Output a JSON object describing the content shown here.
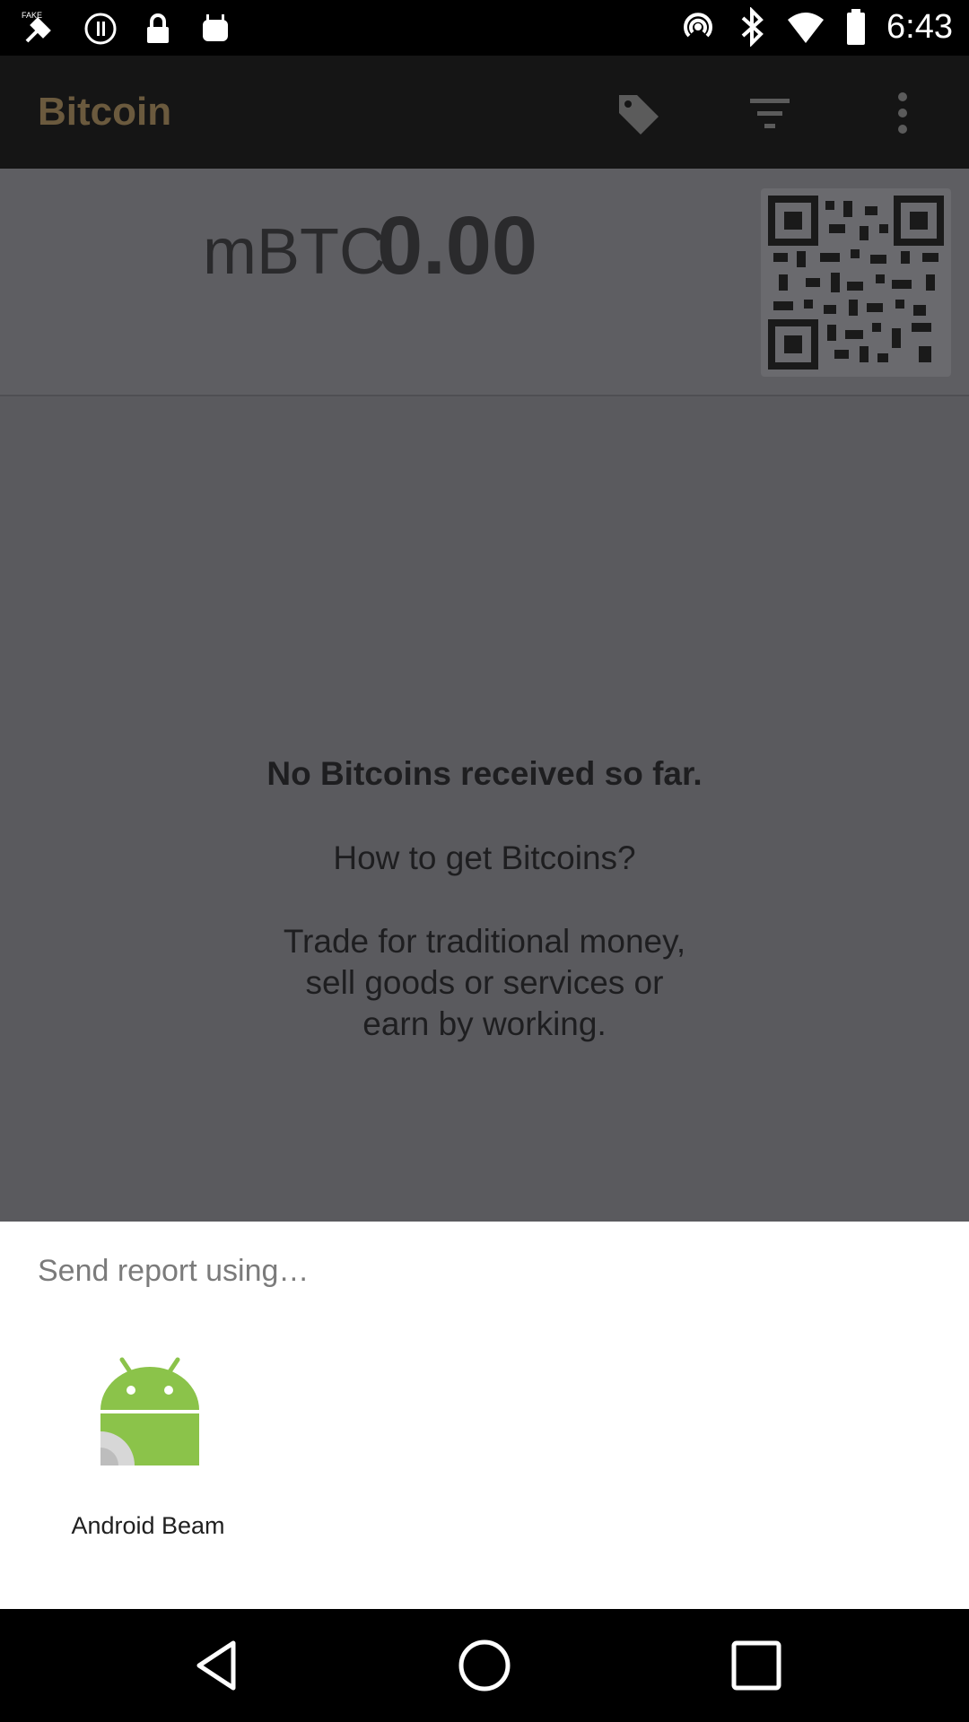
{
  "status_bar": {
    "time": "6:43",
    "left_icons": [
      "fake-gps-icon",
      "lock-icon",
      "lock-icon",
      "android-icon"
    ],
    "right_icons": [
      "hotspot-icon",
      "bluetooth-icon",
      "wifi-icon",
      "battery-icon"
    ]
  },
  "appbar": {
    "title": "Bitcoin",
    "actions": [
      "tag-icon",
      "filter-icon",
      "overflow-menu-icon"
    ]
  },
  "balance": {
    "unit": "mBTC",
    "amount": "0.00"
  },
  "empty_state": {
    "title": "No Bitcoins received so far.",
    "question": "How to get Bitcoins?",
    "lines": [
      "Trade for traditional money,",
      "sell goods or services or",
      "earn by working."
    ]
  },
  "share_sheet": {
    "title": "Send report using…",
    "apps": [
      {
        "label": "Android Beam",
        "icon": "android-beam-icon"
      }
    ]
  },
  "nav_bar": {
    "buttons": [
      "back-icon",
      "home-icon",
      "recents-icon"
    ]
  },
  "colors": {
    "scrim": "#5a5a5e",
    "appbar": "#151515",
    "title_accent": "#6b5a3e",
    "android_green": "#8bc34a"
  }
}
